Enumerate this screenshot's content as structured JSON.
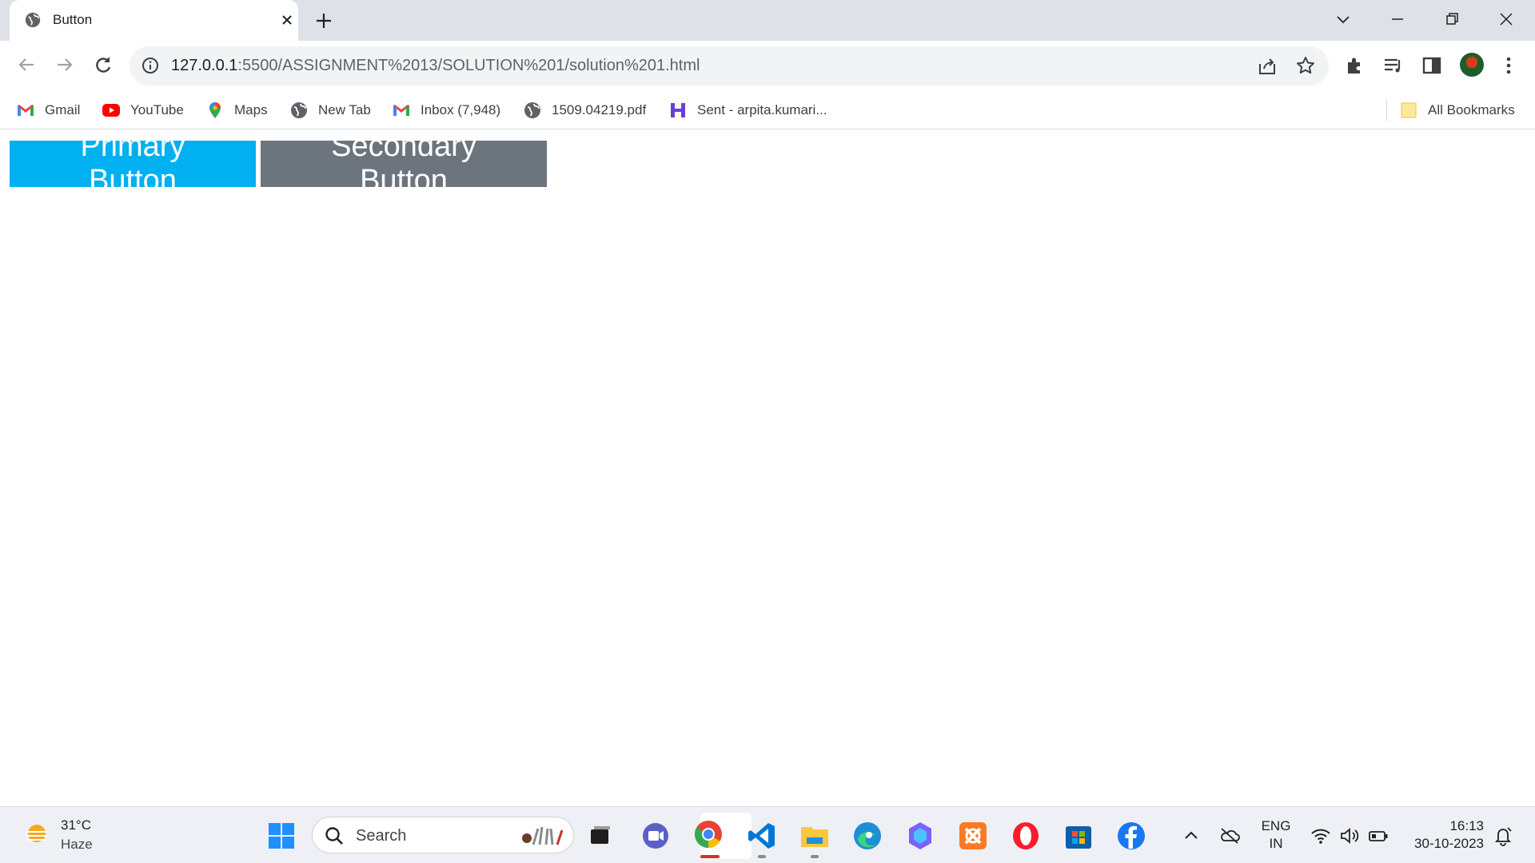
{
  "browser": {
    "tab": {
      "title": "Button"
    },
    "address": {
      "url_host": "127.0.0.1",
      "url_rest": ":5500/ASSIGNMENT%2013/SOLUTION%201/solution%201.html"
    },
    "bookmarks": [
      {
        "label": "Gmail",
        "icon": "gmail-icon"
      },
      {
        "label": "YouTube",
        "icon": "youtube-icon"
      },
      {
        "label": "Maps",
        "icon": "maps-icon"
      },
      {
        "label": "New Tab",
        "icon": "globe-icon"
      },
      {
        "label": "Inbox (7,948)",
        "icon": "gmail-icon"
      },
      {
        "label": "1509.04219.pdf",
        "icon": "globe-icon"
      },
      {
        "label": "Sent - arpita.kumari...",
        "icon": "mail-app-icon"
      }
    ],
    "all_bookmarks": "All Bookmarks"
  },
  "page": {
    "primary_button": "Primary Button",
    "secondary_button": "Secondary Button",
    "colors": {
      "primary": "#00b0f0",
      "secondary": "#6c757d"
    }
  },
  "taskbar": {
    "weather": {
      "temp": "31°C",
      "condition": "Haze"
    },
    "search_label": "Search",
    "lang_line1": "ENG",
    "lang_line2": "IN",
    "time": "16:13",
    "date": "30-10-2023"
  }
}
